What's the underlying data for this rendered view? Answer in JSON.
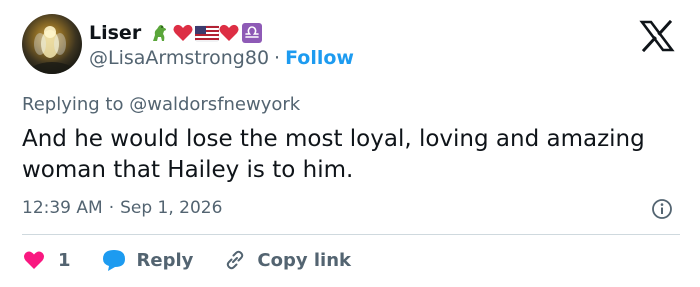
{
  "author": {
    "display_name": "Liser",
    "handle": "@LisaArmstrong80",
    "separator": "·",
    "follow_label": "Follow",
    "emojis": [
      "dinosaur-emoji",
      "red-heart-emoji",
      "us-flag-emoji",
      "red-heart-emoji",
      "libra-emoji"
    ]
  },
  "reply_context": {
    "prefix": "Replying to",
    "handle": "@waldorsfnewyork"
  },
  "tweet": {
    "text": "And he would lose the most loyal, loving and amazing woman that Hailey is to him."
  },
  "meta": {
    "time": "12:39 AM",
    "separator": "·",
    "date": "Sep 1, 2026"
  },
  "actions": {
    "like_count": "1",
    "reply_label": "Reply",
    "copy_label": "Copy link"
  },
  "icons": {
    "brand": "x-logo-icon",
    "info": "info-icon",
    "like": "heart-icon",
    "reply": "speech-bubble-icon",
    "copy": "link-icon"
  },
  "colors": {
    "text": "#0f1419",
    "secondary": "#536471",
    "accent": "#1d9bf0",
    "like": "#f91880",
    "divider": "#cfd9de"
  }
}
